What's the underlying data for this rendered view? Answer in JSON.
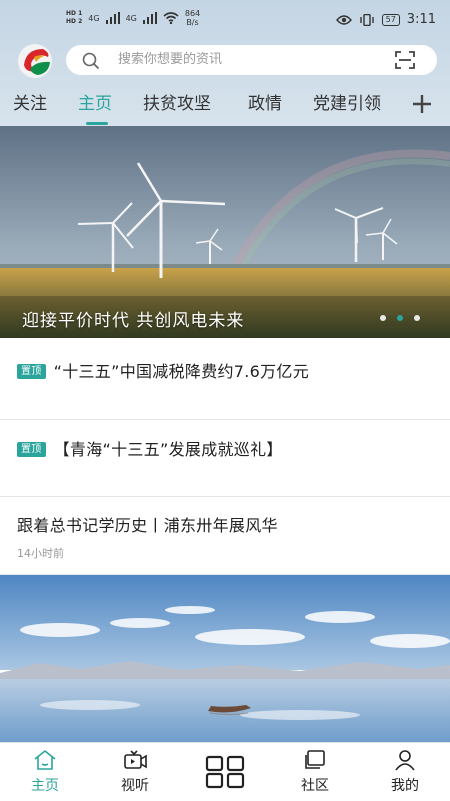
{
  "status_bar": {
    "hd1": "HD 1",
    "hd2": "HD 2",
    "signal1": "4G",
    "signal2": "4G",
    "speed_value": "864",
    "speed_unit": "B/s",
    "battery": "57",
    "time": "3:11"
  },
  "search": {
    "placeholder": "搜索你想要的资讯"
  },
  "tabs": [
    {
      "label": "关注",
      "active": false
    },
    {
      "label": "主页",
      "active": true
    },
    {
      "label": "扶贫攻坚",
      "active": false
    },
    {
      "label": "政情",
      "active": false
    },
    {
      "label": "党建引领",
      "active": false
    }
  ],
  "banner": {
    "caption": "迎接平价时代  共创风电未来",
    "slide_count": 3,
    "active_slide": 2
  },
  "news": [
    {
      "pinned": true,
      "pin_label": "置顶",
      "title": "“十三五”中国减税降费约7.6万亿元"
    },
    {
      "pinned": true,
      "pin_label": "置顶",
      "title": "【青海“十三五”发展成就巡礼】"
    },
    {
      "pinned": false,
      "title": "跟着总书记学历史丨浦东卅年展风华",
      "time": "14小时前"
    }
  ],
  "bottom_nav": [
    {
      "label": "主页",
      "icon": "home-icon",
      "active": true
    },
    {
      "label": "视听",
      "icon": "video-icon",
      "active": false
    },
    {
      "label": "",
      "icon": "grid-icon",
      "active": false
    },
    {
      "label": "社区",
      "icon": "community-icon",
      "active": false
    },
    {
      "label": "我的",
      "icon": "user-icon",
      "active": false
    }
  ],
  "colors": {
    "accent": "#2ba59c",
    "header_bg": "#c9d9e6"
  }
}
